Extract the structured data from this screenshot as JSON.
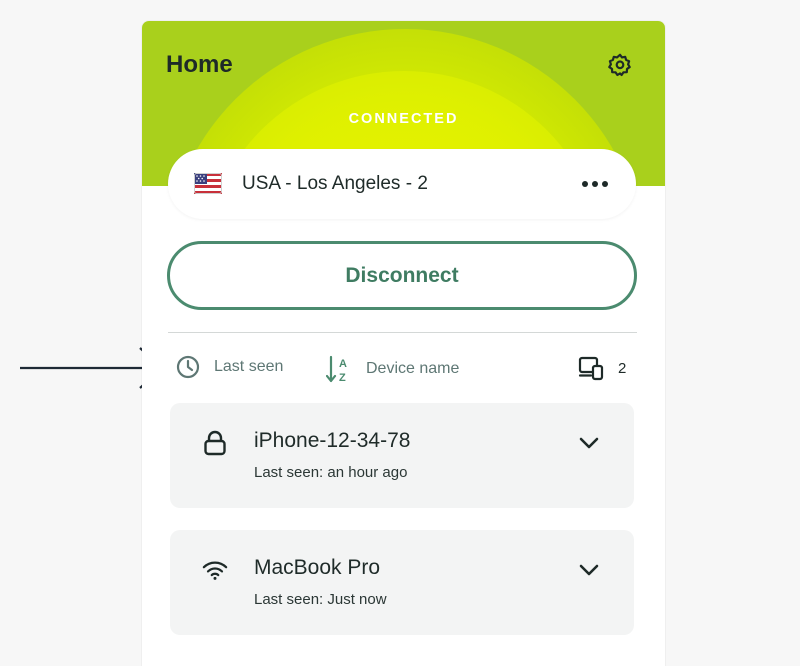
{
  "header": {
    "title": "Home",
    "status": "CONNECTED"
  },
  "location": {
    "name": "USA - Los Angeles - 2",
    "flag_icon": "us-flag-icon"
  },
  "actions": {
    "disconnect_label": "Disconnect"
  },
  "sort": {
    "last_seen_label": "Last seen",
    "device_name_label": "Device name",
    "device_count": "2"
  },
  "devices": [
    {
      "name": "iPhone-12-34-78",
      "last_seen": "Last seen: an hour ago",
      "icon": "lock-icon"
    },
    {
      "name": "MacBook Pro",
      "last_seen": "Last seen: Just now",
      "icon": "wifi-icon"
    }
  ],
  "colors": {
    "accent": "#4b8b6f",
    "hero": "#c5e006",
    "card_bg": "#f3f4f4"
  }
}
